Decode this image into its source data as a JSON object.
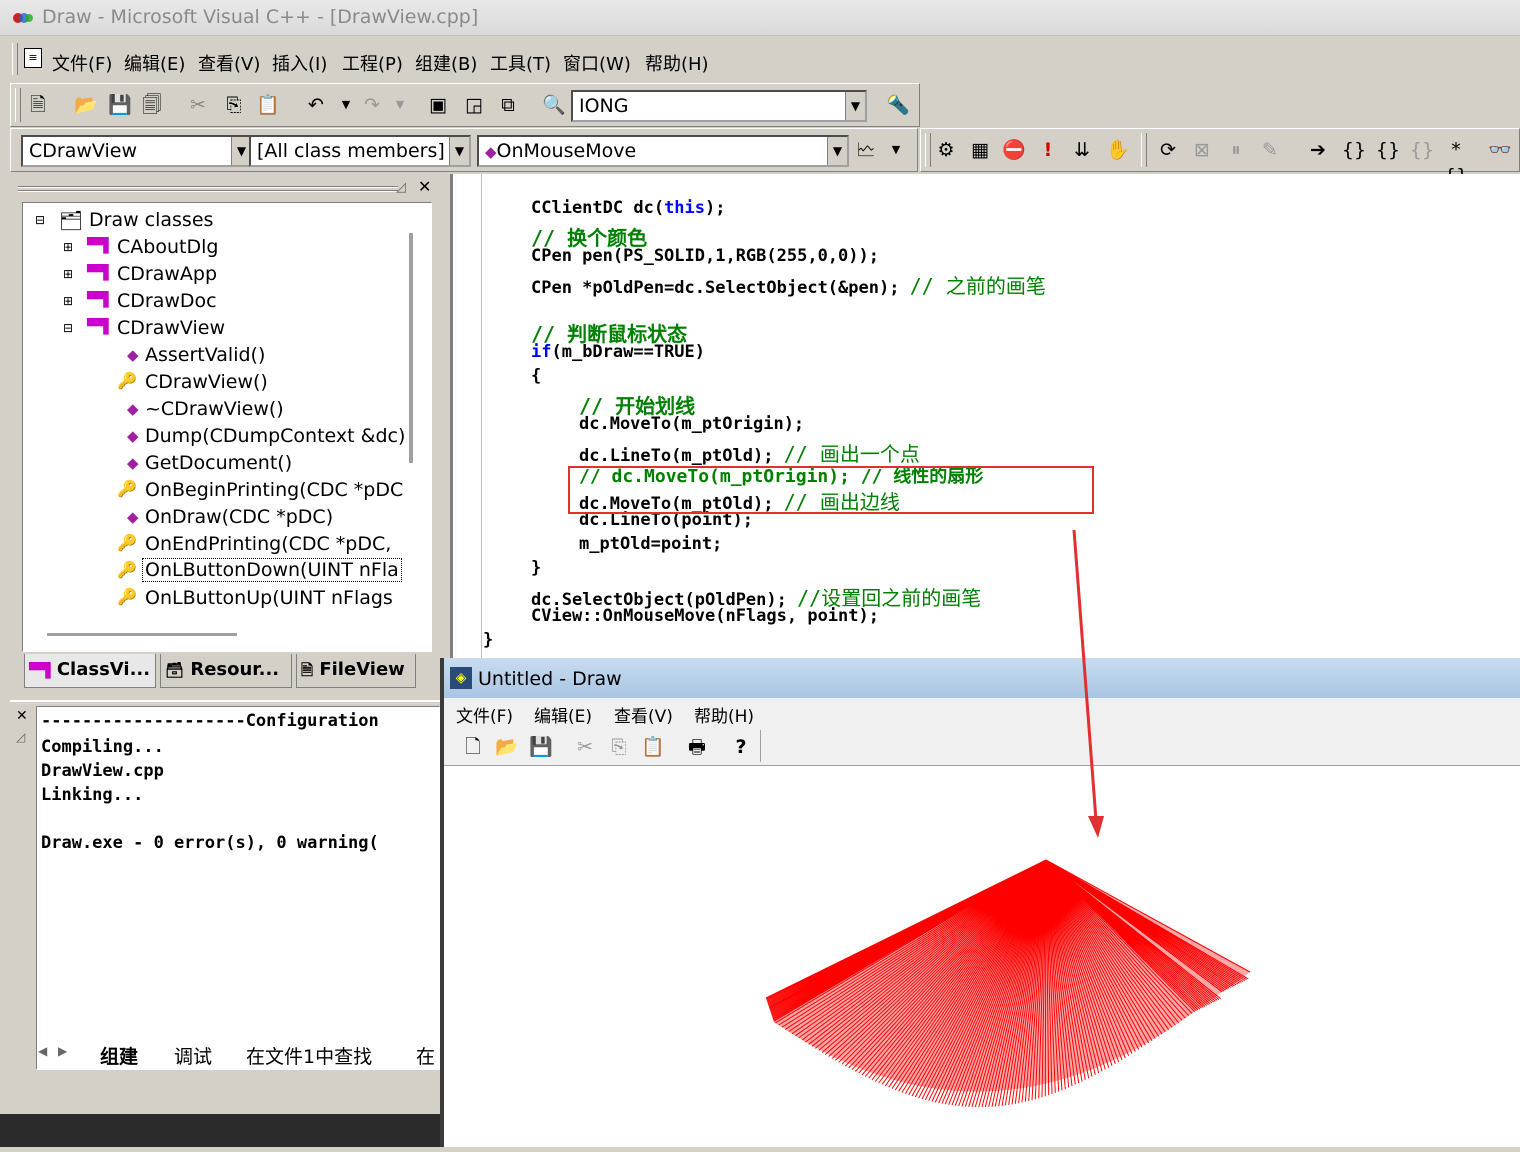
{
  "window": {
    "title": "Draw - Microsoft Visual C++ - [DrawView.cpp]"
  },
  "menu": [
    "文件(F)",
    "编辑(E)",
    "查看(V)",
    "插入(I)",
    "工程(P)",
    "组建(B)",
    "工具(T)",
    "窗口(W)",
    "帮助(H)"
  ],
  "toolbar": {
    "find_combo": "IONG"
  },
  "wizardbar": {
    "class_combo": "CDrawView",
    "filter_combo": "[All class members]",
    "member_combo": "OnMouseMove"
  },
  "classview": {
    "root": "Draw classes",
    "classes": [
      "CAboutDlg",
      "CDrawApp",
      "CDrawDoc",
      "CDrawView"
    ],
    "members": [
      "AssertValid()",
      "CDrawView()",
      "~CDrawView()",
      "Dump(CDumpContext &dc)",
      "GetDocument()",
      "OnBeginPrinting(CDC *pDC",
      "OnDraw(CDC *pDC)",
      "OnEndPrinting(CDC *pDC,",
      "OnLButtonDown(UINT nFla",
      "OnLButtonUp(UINT nFlags"
    ],
    "selected": "OnLButtonDown(UINT nFla"
  },
  "workspace_tabs": [
    "ClassVi...",
    "Resour...",
    "FileView"
  ],
  "code": {
    "l1": "CClientDC dc(",
    "l1kw": "this",
    "l1e": ");",
    "l2": "// 换个颜色",
    "l3": "CPen pen(PS_SOLID,1,RGB(255,0,0));",
    "l4": "CPen *pOldPen=dc.SelectObject(&pen); ",
    "l4c": "// 之前的画笔",
    "l5": "// 判断鼠标状态",
    "l6kw": "if",
    "l6": "(m_bDraw==TRUE)",
    "l7": "{",
    "l8": "// 开始划线",
    "l9": "dc.MoveTo(m_ptOrigin);",
    "l10": "dc.LineTo(m_ptOld); ",
    "l10c": "// 画出一个点",
    "l11": "// dc.MoveTo(m_ptOrigin); // 线性的扇形",
    "l12": "dc.MoveTo(m_ptOld); ",
    "l12c": "// 画出边线",
    "l13": "dc.LineTo(point);",
    "l14": "m_ptOld=point;",
    "l15": "}",
    "l16": "dc.SelectObject(pOldPen); ",
    "l16c": "//设置回之前的画笔",
    "l17": "CView::OnMouseMove(nFlags, point);",
    "l18": "}"
  },
  "output": {
    "lines": [
      "--------------------Configuration",
      "Compiling...",
      "DrawView.cpp",
      "Linking...",
      "",
      "Draw.exe - 0 error(s), 0 warning("
    ],
    "tabs": [
      "组建",
      "调试",
      "在文件1中查找",
      "在"
    ]
  },
  "app": {
    "title": "Untitled - Draw",
    "menu": [
      "文件(F)",
      "编辑(E)",
      "查看(V)",
      "帮助(H)"
    ]
  },
  "colors": {
    "annotation": "#e03030",
    "fan": "#ff0000",
    "comment": "#008000",
    "keyword": "#0000ff"
  }
}
